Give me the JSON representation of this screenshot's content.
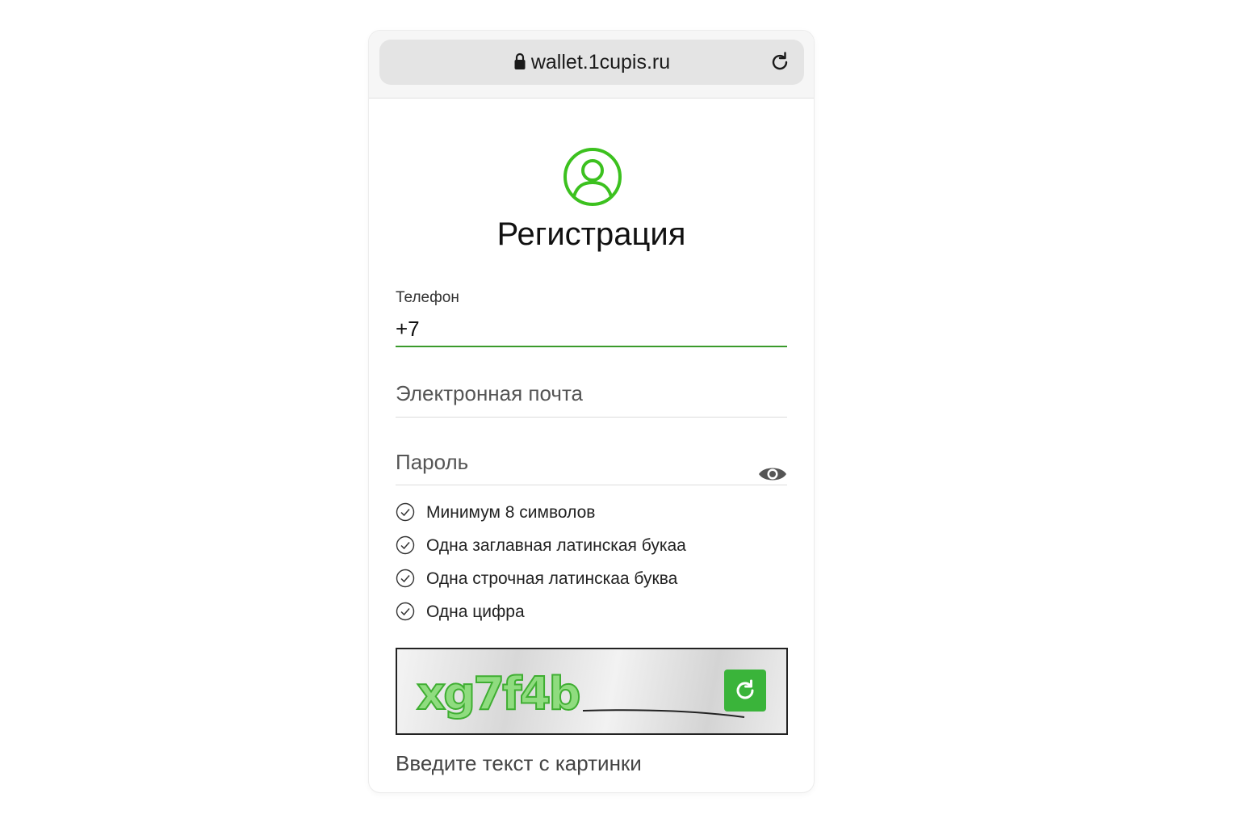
{
  "browser": {
    "url": "wallet.1cupis.ru"
  },
  "page": {
    "title": "Регистрация"
  },
  "form": {
    "phone": {
      "label": "Телефон",
      "value": "+7"
    },
    "email": {
      "placeholder": "Электронная почта"
    },
    "password": {
      "placeholder": "Пароль"
    },
    "password_rules": [
      {
        "text": "Минимум 8 символов"
      },
      {
        "text": "Одна заглавная латинская букаа"
      },
      {
        "text": "Одна строчная латинскаа буква"
      },
      {
        "text": "Одна цифра"
      }
    ],
    "captcha": {
      "text": "xg7f4b",
      "input_placeholder": "Введите текст с картинки"
    }
  },
  "colors": {
    "accent": "#3ab43a",
    "underline_active": "#3a9a2c"
  },
  "icons": {
    "lock": "lock-icon",
    "reload": "reload-icon",
    "avatar": "user-circle-icon",
    "eye": "eye-icon",
    "check": "check-circle-icon",
    "captcha_refresh": "refresh-icon"
  }
}
